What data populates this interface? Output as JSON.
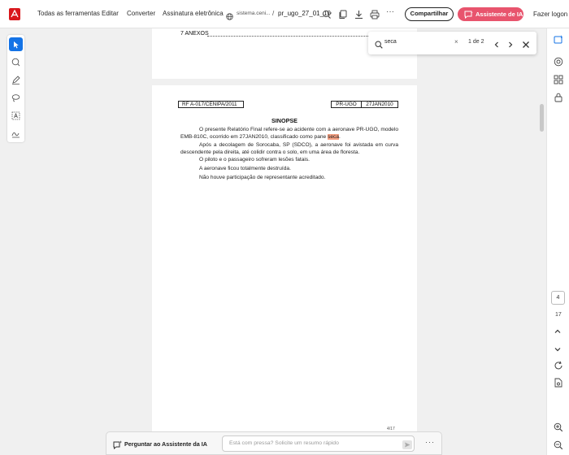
{
  "toolbar": {
    "menu": [
      "Todas as ferramentas",
      "Editar",
      "Converter",
      "Assinatura eletrônica"
    ],
    "domain": "sistema.ceni...",
    "separator": "/",
    "filename": "pr_ugo_27_01_10",
    "share_label": "Compartilhar",
    "ai_label": "Assistente de IA",
    "login_label": "Fazer logon",
    "accent": "#d9171c",
    "ai_color": "#e8546d"
  },
  "left_tools": [
    "select-icon",
    "comment-icon",
    "pen-icon",
    "lasso-icon",
    "text-recognition-icon",
    "sign-icon"
  ],
  "search": {
    "query": "seca",
    "clear": "×",
    "count": "1 de 2"
  },
  "document": {
    "prev_page_line": "7 ANEXOS",
    "header_left": "RF A-017/CENIPA/2011",
    "header_mid": "PR-UGO",
    "header_right": "27JAN2010",
    "title": "SINOPSE",
    "para1_a": "O presente Relatório Final refere-se ao acidente com a aeronave PR-UGO, modelo EMB-810C, ocorrido em 27JAN2010, classificado como pane ",
    "para1_hl": "seca",
    "para1_b": ".",
    "para2": "Após a decolagem de Sorocaba, SP (SDCO), a aeronave foi avistada em curva descendente pela direita, até colidir contra o solo, em uma área de floresta.",
    "para3": "O piloto e o passageiro sofreram lesões fatais.",
    "para4": "A aeronave ficou totalmente destruída.",
    "para5": "Não houve participação de representante acreditado.",
    "corner_mark": "4/17"
  },
  "page_nav": {
    "current": "4",
    "total": "17"
  },
  "ai_bar": {
    "label": "Perguntar ao Assistente da IA",
    "placeholder": "Está com pressa? Solicite um resumo rápido",
    "more": "···"
  }
}
